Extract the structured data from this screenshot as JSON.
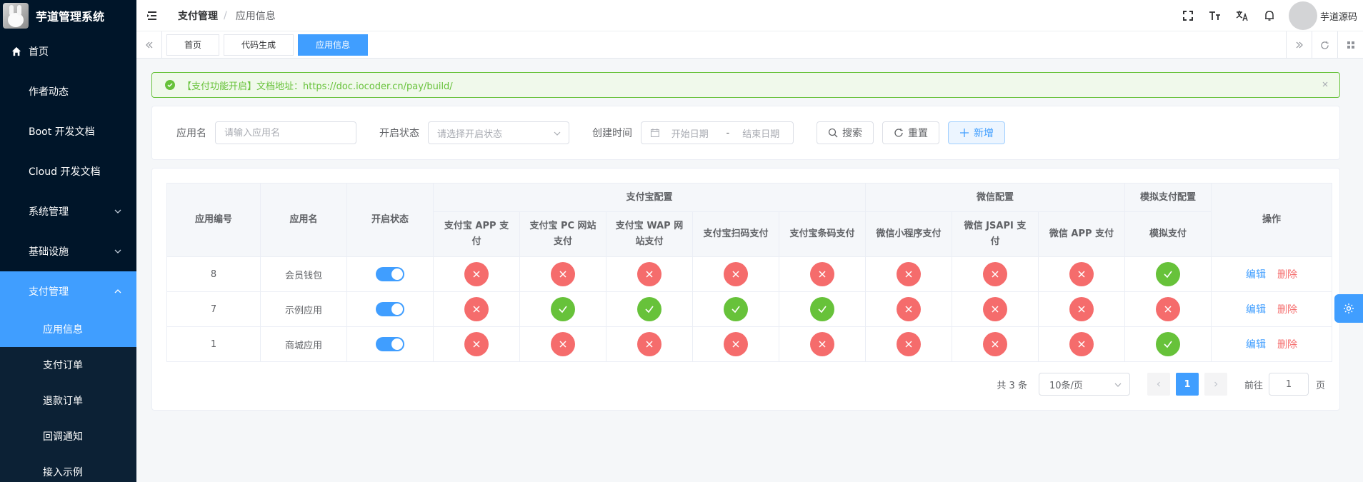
{
  "app": {
    "title": "芋道管理系统"
  },
  "sidebar": {
    "items": [
      {
        "label": "首页"
      },
      {
        "label": "作者动态"
      },
      {
        "label": "Boot 开发文档"
      },
      {
        "label": "Cloud 开发文档"
      },
      {
        "label": "系统管理"
      },
      {
        "label": "基础设施"
      },
      {
        "label": "支付管理"
      }
    ],
    "submenu": [
      {
        "label": "应用信息"
      },
      {
        "label": "支付订单"
      },
      {
        "label": "退款订单"
      },
      {
        "label": "回调通知"
      },
      {
        "label": "接入示例"
      }
    ]
  },
  "header": {
    "breadcrumb_parent": "支付管理",
    "breadcrumb_sep": "/",
    "breadcrumb_current": "应用信息",
    "user_name": "芋道源码"
  },
  "tags": [
    "首页",
    "代码生成",
    "应用信息"
  ],
  "alert": {
    "text": "【支付功能开启】文档地址：https://doc.iocoder.cn/pay/build/"
  },
  "search": {
    "app_name_label": "应用名",
    "app_name_placeholder": "请输入应用名",
    "status_label": "开启状态",
    "status_placeholder": "请选择开启状态",
    "created_label": "创建时间",
    "start_date_placeholder": "开始日期",
    "date_sep": "-",
    "end_date_placeholder": "结束日期",
    "search_button": "搜索",
    "reset_button": "重置",
    "add_button": "新增"
  },
  "table": {
    "group_headers": {
      "id": "应用编号",
      "name": "应用名",
      "status": "开启状态",
      "alipay": "支付宝配置",
      "wx": "微信配置",
      "mock": "模拟支付配置",
      "actions": "操作"
    },
    "sub_headers": [
      "支付宝 APP 支付",
      "支付宝 PC 网站支付",
      "支付宝 WAP 网站支付",
      "支付宝扫码支付",
      "支付宝条码支付",
      "微信小程序支付",
      "微信 JSAPI 支付",
      "微信 APP 支付",
      "模拟支付"
    ],
    "rows": [
      {
        "id": "8",
        "name": "会员钱包",
        "enabled": true,
        "channels": [
          false,
          false,
          false,
          false,
          false,
          false,
          false,
          false,
          true
        ]
      },
      {
        "id": "7",
        "name": "示例应用",
        "enabled": true,
        "channels": [
          false,
          true,
          true,
          true,
          true,
          false,
          false,
          false,
          false
        ]
      },
      {
        "id": "1",
        "name": "商城应用",
        "enabled": true,
        "channels": [
          false,
          false,
          false,
          false,
          false,
          false,
          false,
          false,
          true
        ]
      }
    ],
    "edit_label": "编辑",
    "delete_label": "删除"
  },
  "pagination": {
    "total_text": "共 3 条",
    "page_size": "10条/页",
    "current_page": "1",
    "goto_label": "前往",
    "goto_value": "1",
    "page_suffix": "页"
  },
  "colors": {
    "accent": "#409eff",
    "success": "#67c23a",
    "danger": "#f56c6c",
    "sidebar_bg": "#001529"
  }
}
